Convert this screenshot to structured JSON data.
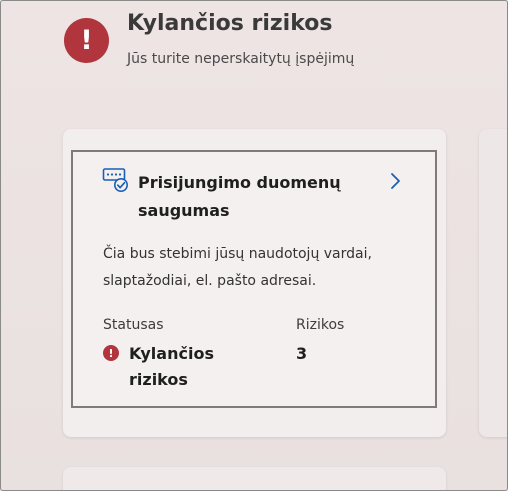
{
  "header": {
    "alert_icon": "exclamation-circle-icon",
    "alert_glyph": "!",
    "title": "Kylančios rizikos",
    "subtitle": "Jūs turite neperskaitytų įspėjimų"
  },
  "card": {
    "icon": "credentials-check-icon",
    "title": "Prisijungimo duomenų saugumas",
    "description": "Čia bus stebimi jūsų naudotojų vardai, slaptažodiai, el. pašto adresai.",
    "status_label": "Statusas",
    "status_value": "Kylančios rizikos",
    "status_glyph": "!",
    "risks_label": "Rizikos",
    "risks_value": "3",
    "chevron_icon": "chevron-right-icon"
  },
  "colors": {
    "background": "#e9e0e0",
    "card": "#f3eeee",
    "alert_red": "#b0353c",
    "accent_blue": "#1a5fb4"
  }
}
